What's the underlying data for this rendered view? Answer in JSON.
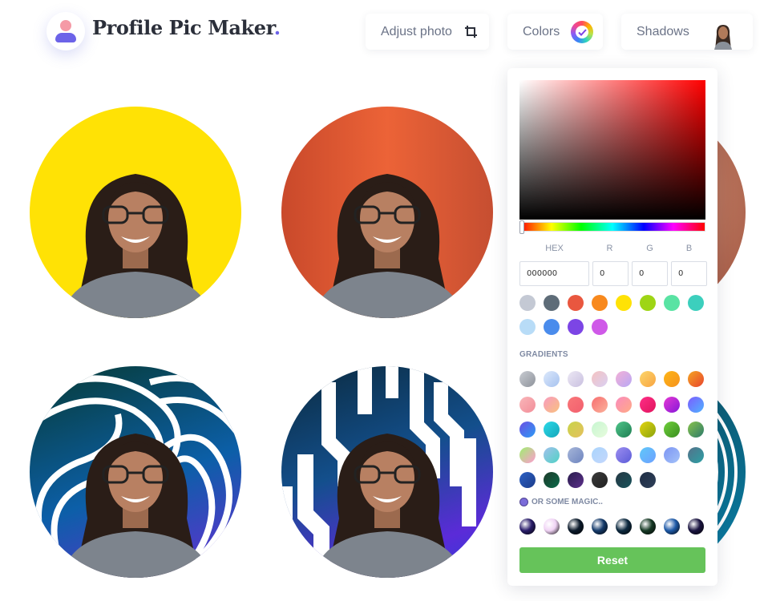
{
  "header": {
    "brand_title": "Profile Pic Maker",
    "brand_dot": "."
  },
  "toolbar": {
    "adjust_label": "Adjust photo",
    "colors_label": "Colors",
    "shadows_label": "Shadows"
  },
  "picker": {
    "hex_label": "HEX",
    "r_label": "R",
    "g_label": "G",
    "b_label": "B",
    "hex_value": "000000",
    "r_value": "0",
    "g_value": "0",
    "b_value": "0",
    "hue": 0
  },
  "solid_colors": [
    "#c4c9d4",
    "#5e6c78",
    "#e9573f",
    "#f8891d",
    "#ffe205",
    "#9ed515",
    "#59e3a3",
    "#3ccfbd",
    "#b8dcf7",
    "#4a8cec",
    "#7c45e5",
    "#cf59e8"
  ],
  "gradients_label": "GRADIENTS",
  "gradients": [
    [
      "#c9ccd2",
      "#8e939b"
    ],
    [
      "#dce8fb",
      "#a6c2ef"
    ],
    [
      "#ece8f4",
      "#c9c0e0"
    ],
    [
      "#f5c2c0",
      "#d9d0f3"
    ],
    [
      "#f3b0d6",
      "#b8a8f5"
    ],
    [
      "#fcd66b",
      "#f8a441"
    ],
    [
      "#fdb617",
      "#f6921e"
    ],
    [
      "#f5a623",
      "#e8442e"
    ],
    [
      "#f9b6b9",
      "#f28e99"
    ],
    [
      "#f79bbf",
      "#f9c17f"
    ],
    [
      "#f97779",
      "#f25f6e"
    ],
    [
      "#f76e70",
      "#fbb29b"
    ],
    [
      "#fa8bbd",
      "#ffaa85"
    ],
    [
      "#ff2d87",
      "#e0155d"
    ],
    [
      "#e638d3",
      "#8618d9"
    ],
    [
      "#7c5cff",
      "#4fb3ff"
    ],
    [
      "#6b4fe3",
      "#2b9cf5"
    ],
    [
      "#2bd9e8",
      "#14a6b9"
    ],
    [
      "#c8d44a",
      "#e5c05e"
    ],
    [
      "#c7f6d1",
      "#e7fbdd"
    ],
    [
      "#4fc58a",
      "#1e7e52"
    ],
    [
      "#e3d40f",
      "#8aa30d"
    ],
    [
      "#6fcf3b",
      "#3a8e20"
    ],
    [
      "#89c34b",
      "#2c7a6b"
    ],
    [
      "#9ef06f",
      "#ff9ad0"
    ],
    [
      "#a2c0eb",
      "#4fd2c5"
    ],
    [
      "#a6b6d9",
      "#6e84bf"
    ],
    [
      "#aad4fb",
      "#c3d7fd"
    ],
    [
      "#9c8ef0",
      "#5b5bd8"
    ],
    [
      "#5fc8f9",
      "#6ea0ff"
    ],
    [
      "#7d95f3",
      "#a3c2f9"
    ],
    [
      "#55718a",
      "#2ba0a4"
    ],
    [
      "#2c60c4",
      "#1b3c8a"
    ],
    [
      "#1d3a2a",
      "#0a6a49"
    ],
    [
      "#2a1d4d",
      "#5b2f8a"
    ],
    [
      "#3a3a3a",
      "#222222"
    ],
    [
      "#263844",
      "#17525a"
    ],
    [
      "#1f2d44",
      "#2e3f58"
    ]
  ],
  "magic_label": "OR SOME MAGIC..",
  "magic": [
    "#2a1d6a",
    "#f0d3f5",
    "#0b1a2b",
    "#153b6b",
    "#0d2a40",
    "#173a26",
    "#1e5aa8",
    "#1a1440"
  ],
  "reset_label": "Reset"
}
